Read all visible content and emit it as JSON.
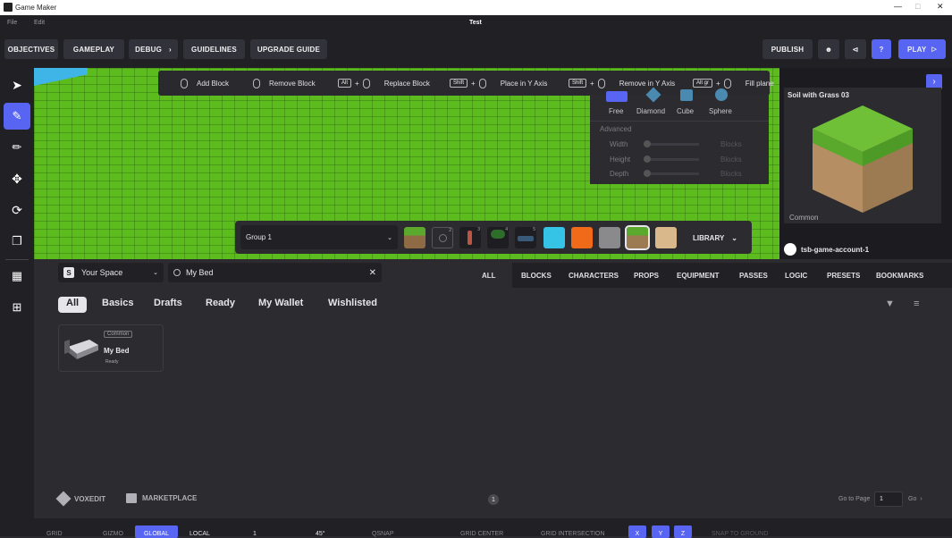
{
  "window": {
    "title": "Game Maker",
    "doc_title": "Test"
  },
  "menu": {
    "file": "File",
    "edit": "Edit"
  },
  "topbar": {
    "objectives": "OBJECTIVES",
    "gameplay": "GAMEPLAY",
    "debug": "DEBUG",
    "guidelines": "GUIDELINES",
    "upgrade_guide": "UPGRADE GUIDE",
    "publish": "PUBLISH",
    "play": "PLAY"
  },
  "hints": {
    "add": "Add Block",
    "remove": "Remove Block",
    "alt": "Alt",
    "replace": "Replace Block",
    "shift": "Shift",
    "place_y": "Place in Y Axis",
    "shift2": "Shift",
    "remove_y": "Remove in Y Axis",
    "altgr": "Alt gr",
    "fill": "Fill plane"
  },
  "shape_panel": {
    "shapes": [
      "Free",
      "Diamond",
      "Cube",
      "Sphere"
    ],
    "advanced": "Advanced",
    "width": "Width",
    "height": "Height",
    "depth": "Depth",
    "unit": "Blocks"
  },
  "preview": {
    "name": "Soil with Grass 03",
    "rarity": "Common",
    "account": "tsb-game-account-1"
  },
  "palette": {
    "group": "Group 1",
    "library": "LIBRARY",
    "counts": [
      "2",
      "3",
      "4",
      "5"
    ]
  },
  "search": {
    "space": "Your Space",
    "query": "My Bed"
  },
  "categories": [
    "ALL",
    "BLOCKS",
    "CHARACTERS",
    "PROPS",
    "EQUIPMENT",
    "PASSES",
    "LOGIC",
    "PRESETS",
    "BOOKMARKS"
  ],
  "filters": [
    "All",
    "Basics",
    "Drafts",
    "Ready",
    "My Wallet",
    "Wishlisted"
  ],
  "card": {
    "badge": "Common",
    "title": "My Bed",
    "status": "Ready"
  },
  "footer": {
    "voxedit": "VOXEDIT",
    "marketplace": "MARKETPLACE",
    "page": "1",
    "goto": "Go to Page",
    "page_value": "1",
    "go": "Go"
  },
  "statusbar": {
    "grid": "GRID",
    "gizmo": "GIZMO",
    "global": "GLOBAL",
    "local": "LOCAL",
    "step": "1",
    "angle": "45°",
    "qsnap": "QSNAP",
    "grid_center": "GRID CENTER",
    "grid_intersection": "GRID INTERSECTION",
    "x": "X",
    "y": "Y",
    "z": "Z",
    "snap_ground": "SNAP TO GROUND"
  },
  "colors": {
    "accent": "#5865f2",
    "grass": "#5cbc1e",
    "panel": "#2b2b30"
  }
}
